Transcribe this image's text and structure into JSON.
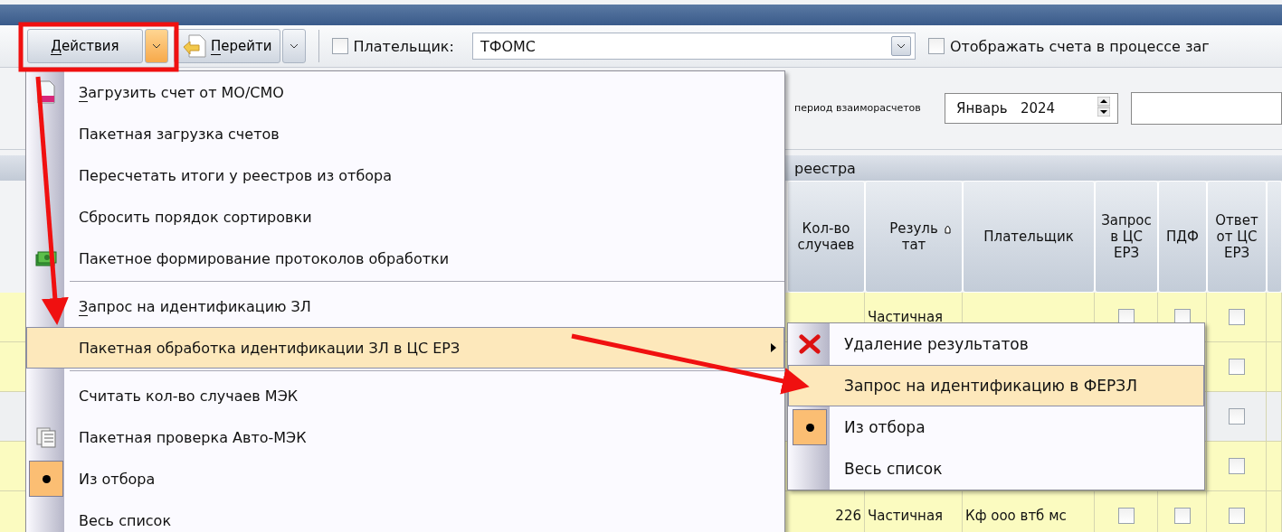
{
  "toolbar": {
    "actions_button": {
      "label": "Действия",
      "accel": true
    },
    "goto_button": {
      "label": "Перейти",
      "accel": true
    },
    "payer_filter": {
      "checked": false,
      "label": "Плательщик:",
      "value": "ТФОМС"
    },
    "show_loading": {
      "checked": false,
      "label": "Отображать счета в процессе заг"
    }
  },
  "period": {
    "label": "период взаиморасчетов",
    "month": "Январь",
    "year": "2024"
  },
  "group_header": "реестра",
  "table": {
    "columns": [
      {
        "label": "Кол-во случаев",
        "sort": false
      },
      {
        "label": "Резуль тат",
        "sort": true
      },
      {
        "label": "Плательщик",
        "sort": false
      },
      {
        "label": "Запрос в ЦС ЕРЗ",
        "sort": false
      },
      {
        "label": "ПДФ",
        "sort": false
      },
      {
        "label": "Ответ от ЦС ЕРЗ",
        "sort": false
      }
    ],
    "rows": [
      {
        "count": "",
        "result": "Частичная",
        "payer": "",
        "checks": [
          false,
          false,
          false
        ]
      },
      {
        "count": "",
        "result": "",
        "payer": "",
        "checks": [
          false
        ]
      },
      {
        "count": "",
        "result": "",
        "payer": "",
        "checks": [
          false
        ]
      },
      {
        "count": "",
        "result": "",
        "payer": "",
        "checks": [
          false
        ]
      },
      {
        "count": "226",
        "result": "Частичная",
        "payer": "Кф ооо втб мс",
        "checks": [
          false,
          false,
          false
        ]
      }
    ]
  },
  "menu": [
    {
      "kind": "item",
      "label": "Загрузить счет от МО/СМО",
      "accel": true,
      "selected": false
    },
    {
      "kind": "item",
      "label": "Пакетная загрузка счетов",
      "selected": false
    },
    {
      "kind": "item",
      "label": "Пересчетать итоги у реестров из отбора",
      "selected": false
    },
    {
      "kind": "item",
      "label": "Сбросить порядок сортировки",
      "selected": false
    },
    {
      "kind": "item",
      "label": "Пакетное формирование протоколов обработки",
      "selected": false
    },
    {
      "kind": "separator"
    },
    {
      "kind": "item",
      "label": "Запрос на идентификацию ЗЛ",
      "accel": true,
      "selected": false
    },
    {
      "kind": "submenu",
      "label": "Пакетная обработка идентификации ЗЛ в ЦС ЕРЗ",
      "selected": true
    },
    {
      "kind": "separator"
    },
    {
      "kind": "item",
      "label": "Считать кол-во случаев МЭК",
      "selected": false
    },
    {
      "kind": "item",
      "label": "Пакетная проверка Авто-МЭК",
      "selected": false
    },
    {
      "kind": "radio",
      "label": "Из отбора",
      "checked": true,
      "selected": false
    },
    {
      "kind": "radio",
      "label": "Весь список",
      "checked": false,
      "selected": false
    }
  ],
  "submenu": [
    {
      "kind": "item",
      "label": "Удаление результатов",
      "selected": false
    },
    {
      "kind": "item",
      "label": "Запрос на идентификацию в ФЕРЗЛ",
      "selected": true
    },
    {
      "kind": "radio",
      "label": "Из отбора",
      "checked": true,
      "selected": false
    },
    {
      "kind": "radio",
      "label": "Весь список",
      "checked": false,
      "selected": false
    }
  ]
}
